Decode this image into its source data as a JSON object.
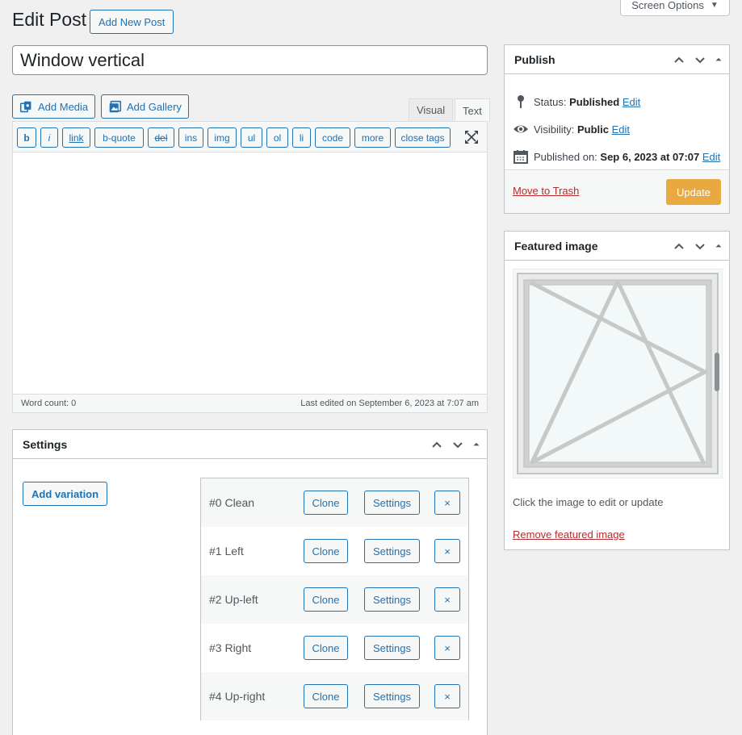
{
  "header": {
    "title": "Edit Post",
    "add_new_label": "Add New Post",
    "screen_options_label": "Screen Options"
  },
  "post": {
    "title_value": "Window vertical"
  },
  "media": {
    "add_media_label": "Add Media",
    "add_gallery_label": "Add Gallery"
  },
  "editor": {
    "tabs": [
      "Visual",
      "Text"
    ],
    "active_tab": "Text",
    "quicktags": [
      "b",
      "i",
      "link",
      "b-quote",
      "del",
      "ins",
      "img",
      "ul",
      "ol",
      "li",
      "code",
      "more",
      "close tags"
    ],
    "word_count": "Word count: 0",
    "last_edited": "Last edited on September 6, 2023 at 7:07 am",
    "content": ""
  },
  "settings": {
    "title": "Settings",
    "add_variation_label": "Add variation",
    "variations": [
      {
        "label": "#0 Clean",
        "clone": "Clone",
        "settings": "Settings",
        "remove": "×"
      },
      {
        "label": "#1 Left",
        "clone": "Clone",
        "settings": "Settings",
        "remove": "×"
      },
      {
        "label": "#2 Up-left",
        "clone": "Clone",
        "settings": "Settings",
        "remove": "×"
      },
      {
        "label": "#3 Right",
        "clone": "Clone",
        "settings": "Settings",
        "remove": "×"
      },
      {
        "label": "#4 Up-right",
        "clone": "Clone",
        "settings": "Settings",
        "remove": "×"
      }
    ]
  },
  "publish": {
    "title": "Publish",
    "status_label": "Status:",
    "status_value": "Published",
    "visibility_label": "Visibility:",
    "visibility_value": "Public",
    "published_label": "Published on:",
    "published_value": "Sep 6, 2023 at 07:07",
    "edit_label": "Edit",
    "trash_label": "Move to Trash",
    "update_label": "Update"
  },
  "featured": {
    "title": "Featured image",
    "hint": "Click the image to edit or update",
    "remove_label": "Remove featured image"
  },
  "colors": {
    "accent": "#2271b1",
    "update_button": "#e8a940",
    "danger_link": "#b32d2e",
    "background": "#f0f0f1"
  }
}
